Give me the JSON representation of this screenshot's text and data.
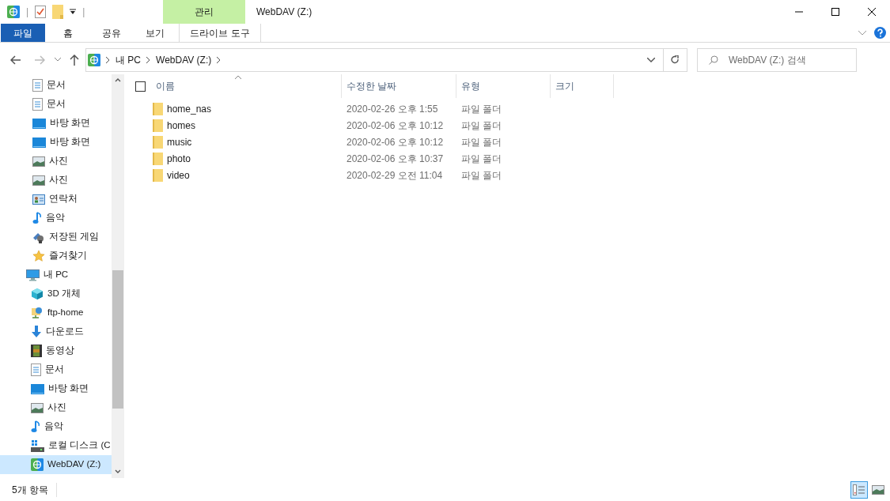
{
  "window": {
    "title": "WebDAV (Z:)"
  },
  "quick_access_separator": "|",
  "context_tab": {
    "group": "관리",
    "label": "드라이브 도구"
  },
  "ribbon_tabs": [
    {
      "label": "파일",
      "selected": true
    },
    {
      "label": "홈",
      "selected": false
    },
    {
      "label": "공유",
      "selected": false
    },
    {
      "label": "보기",
      "selected": false
    }
  ],
  "address_bar": {
    "crumbs": [
      "내 PC",
      "WebDAV (Z:)"
    ]
  },
  "search": {
    "placeholder": "WebDAV (Z:) 검색"
  },
  "sidebar": {
    "continued_items": [
      {
        "label": "문서",
        "kind": "documents",
        "selected": false
      },
      {
        "label": "문서",
        "kind": "documents",
        "selected": false
      },
      {
        "label": "바탕 화면",
        "kind": "desktop",
        "selected": false
      },
      {
        "label": "바탕 화면",
        "kind": "desktop",
        "selected": false
      },
      {
        "label": "사진",
        "kind": "pictures",
        "selected": false
      },
      {
        "label": "사진",
        "kind": "pictures",
        "selected": false
      },
      {
        "label": "연락처",
        "kind": "contacts",
        "selected": false
      },
      {
        "label": "음악",
        "kind": "music",
        "selected": false
      },
      {
        "label": "저장된 게임",
        "kind": "games",
        "selected": false
      },
      {
        "label": "즐겨찾기",
        "kind": "favorites",
        "selected": false
      }
    ],
    "items": [
      {
        "label": "내 PC",
        "kind": "pc",
        "selected": false,
        "children": [
          {
            "label": "3D 개체",
            "kind": "objects",
            "selected": false
          },
          {
            "label": "ftp-home",
            "kind": "network",
            "selected": false
          },
          {
            "label": "다운로드",
            "kind": "downloads",
            "selected": false
          },
          {
            "label": "동영상",
            "kind": "videos",
            "selected": false
          },
          {
            "label": "문서",
            "kind": "documents",
            "selected": false
          },
          {
            "label": "바탕 화면",
            "kind": "desktop",
            "selected": false
          },
          {
            "label": "사진",
            "kind": "pictures",
            "selected": false
          },
          {
            "label": "음악",
            "kind": "music",
            "selected": false
          },
          {
            "label": "로컬 디스크 (C",
            "kind": "disk",
            "selected": false
          },
          {
            "label": "WebDAV (Z:)",
            "kind": "webdav",
            "selected": true
          }
        ]
      }
    ]
  },
  "table": {
    "select_all": {
      "checked": false
    },
    "columns": [
      "이름",
      "수정한 날짜",
      "유형",
      "크기"
    ],
    "rows": [
      {
        "name": "home_nas",
        "modified": "2020-02-26 오후 1:55",
        "type": "파일 폴더"
      },
      {
        "name": "homes",
        "modified": "2020-02-06 오후 10:12",
        "type": "파일 폴더"
      },
      {
        "name": "music",
        "modified": "2020-02-06 오후 10:12",
        "type": "파일 폴더"
      },
      {
        "name": "photo",
        "modified": "2020-02-06 오후 10:37",
        "type": "파일 폴더"
      },
      {
        "name": "video",
        "modified": "2020-02-29 오전 11:04",
        "type": "파일 폴더"
      }
    ]
  },
  "status_bar": {
    "item_count": "5개 항목",
    "views": [
      {
        "kind": "details",
        "selected": true
      },
      {
        "kind": "thumbnails",
        "selected": false
      }
    ]
  }
}
